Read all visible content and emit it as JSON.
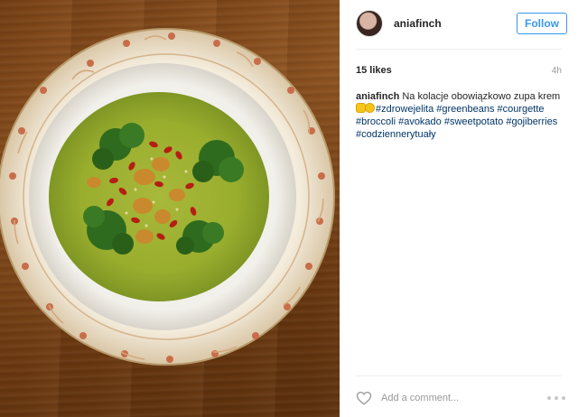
{
  "post": {
    "username": "aniafinch",
    "follow_label": "Follow",
    "likes": "15 likes",
    "time": "4h",
    "caption": {
      "username": "aniafinch",
      "text_before_emoji": "Na kolacje obowiązkowo zupa krem",
      "hashtags": "#zdrowejelita #greenbeans #courgette #broccoli #avokado #sweetpotato #gojiberries #codziennerytuały"
    },
    "comment_placeholder": "Add a comment..."
  },
  "icons": {
    "avatar": "profile-photo",
    "like": "heart-outline-icon",
    "more": "more-options-icon",
    "emoji": "thumbs-up-smiley-emoji"
  },
  "colors": {
    "link_blue": "#3897f0",
    "hashtag_blue": "#003569",
    "secondary_gray": "#999999"
  }
}
